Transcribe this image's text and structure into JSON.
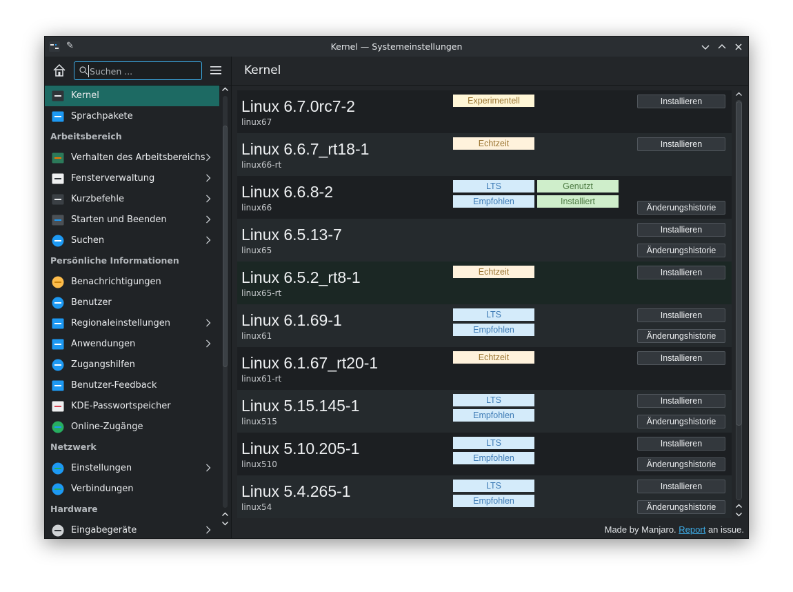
{
  "window": {
    "title": "Kernel — Systemeinstellungen"
  },
  "sidebar": {
    "search_placeholder": "Suchen ...",
    "items_top": [
      {
        "label": "Kernel",
        "icon": "kernel-icon",
        "active": true
      },
      {
        "label": "Sprachpakete",
        "icon": "language-packages-icon"
      }
    ],
    "sections": [
      {
        "title": "Arbeitsbereich",
        "items": [
          {
            "label": "Verhalten des Arbeitsbereichs",
            "icon": "workspace-behavior-icon",
            "arrow": true
          },
          {
            "label": "Fensterverwaltung",
            "icon": "window-management-icon",
            "arrow": true
          },
          {
            "label": "Kurzbefehle",
            "icon": "keyboard-icon",
            "arrow": true
          },
          {
            "label": "Starten und Beenden",
            "icon": "startup-shutdown-icon",
            "arrow": true
          },
          {
            "label": "Suchen",
            "icon": "search-settings-icon",
            "arrow": true
          }
        ]
      },
      {
        "title": "Persönliche Informationen",
        "items": [
          {
            "label": "Benachrichtigungen",
            "icon": "bell-icon"
          },
          {
            "label": "Benutzer",
            "icon": "users-icon"
          },
          {
            "label": "Regionaleinstellungen",
            "icon": "regional-settings-icon",
            "arrow": true
          },
          {
            "label": "Anwendungen",
            "icon": "applications-icon",
            "arrow": true
          },
          {
            "label": "Zugangshilfen",
            "icon": "accessibility-icon"
          },
          {
            "label": "Benutzer-Feedback",
            "icon": "feedback-icon"
          },
          {
            "label": "KDE-Passwortspeicher",
            "icon": "wallet-icon"
          },
          {
            "label": "Online-Zugänge",
            "icon": "online-accounts-icon"
          }
        ]
      },
      {
        "title": "Netzwerk",
        "items": [
          {
            "label": "Einstellungen",
            "icon": "network-globe-icon",
            "arrow": true
          },
          {
            "label": "Verbindungen",
            "icon": "connections-globe-icon"
          }
        ]
      },
      {
        "title": "Hardware",
        "items": [
          {
            "label": "Eingabegeräte",
            "icon": "input-devices-icon",
            "arrow": true
          }
        ]
      }
    ]
  },
  "main": {
    "title": "Kernel",
    "footer": {
      "prefix": "Made by Manjaro.",
      "link": "Report",
      "suffix": "an issue."
    }
  },
  "kernels": [
    {
      "name": "Linux 6.7.0rc7-2",
      "pkg": "linux67",
      "badges": [
        [
          "Experimentell",
          "exp",
          0,
          0
        ]
      ],
      "buttons": [
        "Installieren"
      ]
    },
    {
      "name": "Linux 6.6.7_rt18-1",
      "pkg": "linux66-rt",
      "badges": [
        [
          "Echtzeit",
          "rt",
          0,
          0
        ]
      ],
      "buttons": [
        "Installieren"
      ]
    },
    {
      "name": "Linux 6.6.8-2",
      "pkg": "linux66",
      "badges": [
        [
          "LTS",
          "lts",
          0,
          0
        ],
        [
          "Empfohlen",
          "rec",
          0,
          1
        ],
        [
          "Genutzt",
          "used",
          1,
          0
        ],
        [
          "Installiert",
          "inst",
          1,
          1
        ]
      ],
      "buttons": [
        null,
        "Änderungshistorie"
      ]
    },
    {
      "name": "Linux 6.5.13-7",
      "pkg": "linux65",
      "badges": [],
      "buttons": [
        "Installieren",
        "Änderungshistorie"
      ]
    },
    {
      "name": "Linux 6.5.2_rt8-1",
      "pkg": "linux65-rt",
      "badges": [
        [
          "Echtzeit",
          "rt",
          0,
          0
        ]
      ],
      "buttons": [
        "Installieren"
      ]
    },
    {
      "name": "Linux 6.1.69-1",
      "pkg": "linux61",
      "badges": [
        [
          "LTS",
          "lts",
          0,
          0
        ],
        [
          "Empfohlen",
          "rec",
          0,
          1
        ]
      ],
      "buttons": [
        "Installieren",
        "Änderungshistorie"
      ]
    },
    {
      "name": "Linux 6.1.67_rt20-1",
      "pkg": "linux61-rt",
      "badges": [
        [
          "Echtzeit",
          "rt",
          0,
          0
        ]
      ],
      "buttons": [
        "Installieren"
      ]
    },
    {
      "name": "Linux 5.15.145-1",
      "pkg": "linux515",
      "badges": [
        [
          "LTS",
          "lts",
          0,
          0
        ],
        [
          "Empfohlen",
          "rec",
          0,
          1
        ]
      ],
      "buttons": [
        "Installieren",
        "Änderungshistorie"
      ]
    },
    {
      "name": "Linux 5.10.205-1",
      "pkg": "linux510",
      "badges": [
        [
          "LTS",
          "lts",
          0,
          0
        ],
        [
          "Empfohlen",
          "rec",
          0,
          1
        ]
      ],
      "buttons": [
        "Installieren",
        "Änderungshistorie"
      ]
    },
    {
      "name": "Linux 5.4.265-1",
      "pkg": "linux54",
      "badges": [
        [
          "LTS",
          "lts",
          0,
          0
        ],
        [
          "Empfohlen",
          "rec",
          0,
          1
        ]
      ],
      "buttons": [
        "Installieren",
        "Änderungshistorie"
      ]
    }
  ]
}
